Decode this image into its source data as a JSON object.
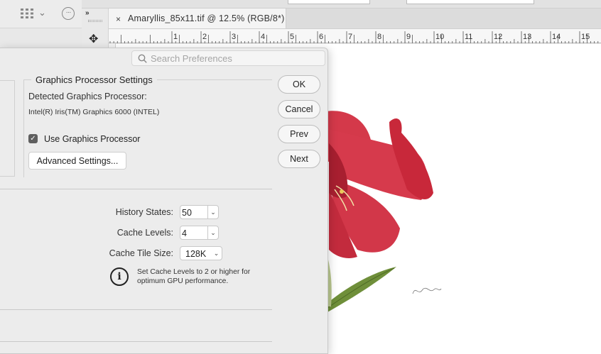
{
  "document": {
    "tab_title": "Amaryllis_85x11.tif @ 12.5% (RGB/8*)",
    "close_glyph": "×"
  },
  "ruler": {
    "labels": [
      "1",
      "2",
      "3",
      "4",
      "5",
      "6",
      "7",
      "8",
      "9",
      "10",
      "11",
      "12",
      "13",
      "14",
      "15"
    ]
  },
  "toolbar": {
    "collapse_glyph": "»",
    "move_glyph": "✥",
    "chevron_glyph": "⌄",
    "more_glyph": "···"
  },
  "preferences": {
    "search": {
      "placeholder": "Search Preferences"
    },
    "gpu_group": {
      "title": "Graphics Processor Settings",
      "detected_label": "Detected Graphics Processor:",
      "detected_value": "Intel(R) Iris(TM) Graphics 6000 (INTEL)",
      "use_gpu_label": "Use Graphics Processor",
      "use_gpu_checked": true,
      "advanced_button": "Advanced Settings..."
    },
    "history_cache": {
      "history_states_label": "History States:",
      "history_states_value": "50",
      "cache_levels_label": "Cache Levels:",
      "cache_levels_value": "4",
      "cache_tile_size_label": "Cache Tile Size:",
      "cache_tile_size_value": "128K",
      "info_text": "Set Cache Levels to 2 or higher for optimum GPU performance."
    },
    "buttons": {
      "ok": "OK",
      "cancel": "Cancel",
      "prev": "Prev",
      "next": "Next"
    }
  },
  "colors": {
    "petal": "#d4394a",
    "petal_dark": "#a81f30",
    "leaf": "#6f8f3a",
    "dialog_bg": "#ececec"
  },
  "icons": [
    "grid-icon",
    "chevron-down-icon",
    "more-icon",
    "move-tool-icon",
    "search-icon",
    "info-icon",
    "checkbox-checked-icon"
  ]
}
